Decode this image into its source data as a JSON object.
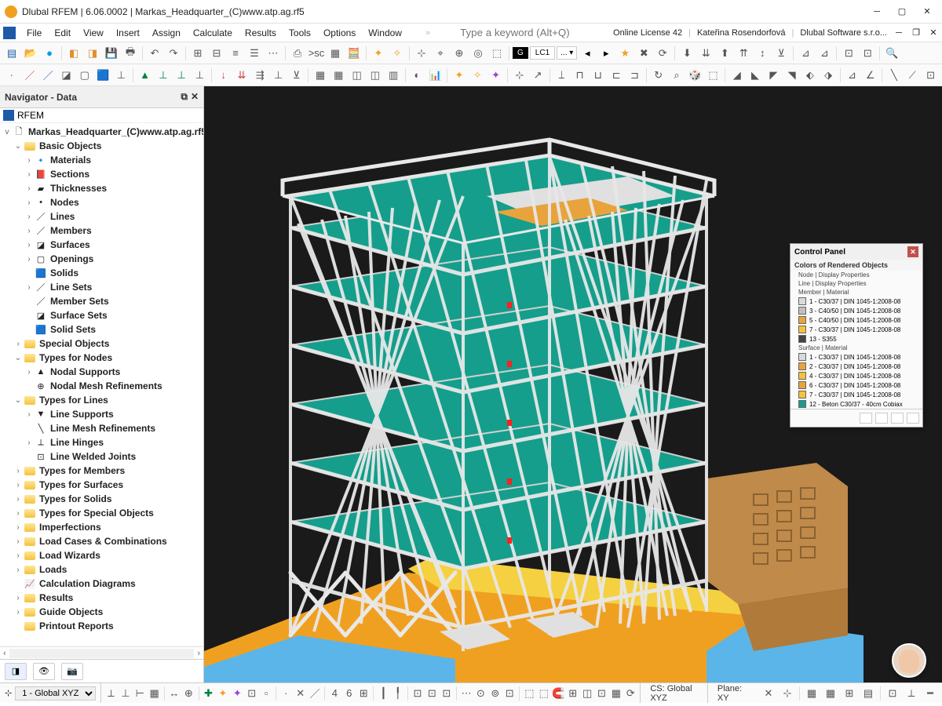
{
  "title": "Dlubal RFEM | 6.06.0002 | Markas_Headquarter_(C)www.atp.ag.rf5",
  "menu": [
    "File",
    "Edit",
    "View",
    "Insert",
    "Assign",
    "Calculate",
    "Results",
    "Tools",
    "Options",
    "Window"
  ],
  "search_placeholder": "Type a keyword (Alt+Q)",
  "license_text": "Online License 42",
  "user_text": "Kateřina Rosendorfová",
  "company_text": "Dlubal Software s.r.o...",
  "loadcase": {
    "g": "G",
    "l": "LC1",
    "d": "..."
  },
  "navigator": {
    "title": "Navigator - Data",
    "root": "RFEM",
    "project": "Markas_Headquarter_(C)www.atp.ag.rf5",
    "tree": [
      {
        "d": 1,
        "tw": "v",
        "icon": "fold",
        "label": "Basic Objects"
      },
      {
        "d": 2,
        "tw": ">",
        "icon": "🔹",
        "label": "Materials"
      },
      {
        "d": 2,
        "tw": ">",
        "icon": "📕",
        "label": "Sections"
      },
      {
        "d": 2,
        "tw": ">",
        "icon": "▰",
        "label": "Thicknesses"
      },
      {
        "d": 2,
        "tw": ">",
        "icon": "•",
        "label": "Nodes"
      },
      {
        "d": 2,
        "tw": ">",
        "icon": "／",
        "label": "Lines"
      },
      {
        "d": 2,
        "tw": ">",
        "icon": "／",
        "label": "Members"
      },
      {
        "d": 2,
        "tw": ">",
        "icon": "◪",
        "label": "Surfaces"
      },
      {
        "d": 2,
        "tw": ">",
        "icon": "▢",
        "label": "Openings"
      },
      {
        "d": 2,
        "tw": "",
        "icon": "🟦",
        "label": "Solids"
      },
      {
        "d": 2,
        "tw": ">",
        "icon": "／",
        "label": "Line Sets"
      },
      {
        "d": 2,
        "tw": "",
        "icon": "／",
        "label": "Member Sets"
      },
      {
        "d": 2,
        "tw": "",
        "icon": "◪",
        "label": "Surface Sets"
      },
      {
        "d": 2,
        "tw": "",
        "icon": "🟦",
        "label": "Solid Sets"
      },
      {
        "d": 1,
        "tw": ">",
        "icon": "fold",
        "label": "Special Objects"
      },
      {
        "d": 1,
        "tw": "v",
        "icon": "fold",
        "label": "Types for Nodes"
      },
      {
        "d": 2,
        "tw": ">",
        "icon": "▲",
        "label": "Nodal Supports"
      },
      {
        "d": 2,
        "tw": "",
        "icon": "⊕",
        "label": "Nodal Mesh Refinements"
      },
      {
        "d": 1,
        "tw": "v",
        "icon": "fold",
        "label": "Types for Lines"
      },
      {
        "d": 2,
        "tw": ">",
        "icon": "▼",
        "label": "Line Supports"
      },
      {
        "d": 2,
        "tw": "",
        "icon": "╲",
        "label": "Line Mesh Refinements"
      },
      {
        "d": 2,
        "tw": ">",
        "icon": "⟂",
        "label": "Line Hinges"
      },
      {
        "d": 2,
        "tw": "",
        "icon": "⊡",
        "label": "Line Welded Joints"
      },
      {
        "d": 1,
        "tw": ">",
        "icon": "fold",
        "label": "Types for Members"
      },
      {
        "d": 1,
        "tw": ">",
        "icon": "fold",
        "label": "Types for Surfaces"
      },
      {
        "d": 1,
        "tw": ">",
        "icon": "fold",
        "label": "Types for Solids"
      },
      {
        "d": 1,
        "tw": ">",
        "icon": "fold",
        "label": "Types for Special Objects"
      },
      {
        "d": 1,
        "tw": ">",
        "icon": "fold",
        "label": "Imperfections"
      },
      {
        "d": 1,
        "tw": ">",
        "icon": "fold",
        "label": "Load Cases & Combinations"
      },
      {
        "d": 1,
        "tw": ">",
        "icon": "fold",
        "label": "Load Wizards"
      },
      {
        "d": 1,
        "tw": ">",
        "icon": "fold",
        "label": "Loads"
      },
      {
        "d": 1,
        "tw": "",
        "icon": "📈",
        "label": "Calculation Diagrams"
      },
      {
        "d": 1,
        "tw": ">",
        "icon": "fold",
        "label": "Results"
      },
      {
        "d": 1,
        "tw": ">",
        "icon": "fold",
        "label": "Guide Objects"
      },
      {
        "d": 1,
        "tw": "",
        "icon": "fold",
        "label": "Printout Reports"
      }
    ]
  },
  "control_panel": {
    "title": "Control Panel",
    "section": "Colors of Rendered Objects",
    "groups": [
      {
        "label": "Node | Display Properties",
        "items": []
      },
      {
        "label": "Line | Display Properties",
        "items": []
      },
      {
        "label": "Member | Material",
        "items": [
          {
            "c": "#d9d9d9",
            "t": "1 - C30/37 | DIN 1045-1:2008-08"
          },
          {
            "c": "#bfbfbf",
            "t": "3 - C40/50 | DIN 1045-1:2008-08"
          },
          {
            "c": "#e8a33d",
            "t": "5 - C40/50 | DIN 1045-1:2008-08"
          },
          {
            "c": "#f5c23d",
            "t": "7 - C30/37 | DIN 1045-1:2008-08"
          },
          {
            "c": "#444444",
            "t": "13 - S355"
          }
        ]
      },
      {
        "label": "Surface | Material",
        "items": [
          {
            "c": "#d9d9d9",
            "t": "1 - C30/37 | DIN 1045-1:2008-08"
          },
          {
            "c": "#e8a33d",
            "t": "2 - C30/37 | DIN 1045-1:2008-08"
          },
          {
            "c": "#f5c23d",
            "t": "4 - C30/37 | DIN 1045-1:2008-08"
          },
          {
            "c": "#e8a33d",
            "t": "6 - C30/37 | DIN 1045-1:2008-08"
          },
          {
            "c": "#f5c23d",
            "t": "7 - C30/37 | DIN 1045-1:2008-08"
          },
          {
            "c": "#159e8c",
            "t": "12 - Beton C30/37 - 40cm Cobiax"
          }
        ]
      }
    ]
  },
  "statusbar": {
    "coord_label": "1 - Global XYZ",
    "cs": "CS: Global XYZ",
    "plane": "Plane: XY"
  }
}
